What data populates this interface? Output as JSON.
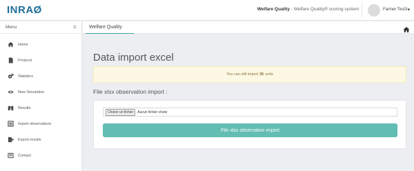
{
  "header": {
    "brand": "INRAØ",
    "app_title_bold": "Welfare Quality",
    "app_title_rest": " - Welfare Quality® scoring system",
    "user_name": "Farmer Test3",
    "user_caret": "▾"
  },
  "sidebar": {
    "menu_label": "Menu",
    "toggle_icon": "≡",
    "items": [
      {
        "label": "Home",
        "icon": "home-icon"
      },
      {
        "label": "Protocol",
        "icon": "file-icon"
      },
      {
        "label": "Statistics",
        "icon": "cogs-icon"
      },
      {
        "label": "New Simulation",
        "icon": "eye-icon"
      },
      {
        "label": "Results",
        "icon": "binoculars-icon"
      },
      {
        "label": "Import observations",
        "icon": "list-icon"
      },
      {
        "label": "Export results",
        "icon": "export-icon"
      },
      {
        "label": "Contact",
        "icon": "envelope-icon"
      }
    ]
  },
  "breadcrumb": {
    "title": "Welfare Quality"
  },
  "main": {
    "heading": "Data import excel",
    "alert_prefix": "You can still import",
    "alert_count": "36",
    "alert_suffix": "units",
    "section_label": "File xlsx observation import :",
    "file_button": "Choisir un fichier",
    "file_status": "Aucun fichier choisi",
    "submit_label": "File xlsx observation import"
  },
  "colors": {
    "brand": "#1f6f9a",
    "accent": "#62bdb3",
    "alert_bg": "#fcf8e3",
    "alert_text": "#8a6d3b"
  }
}
